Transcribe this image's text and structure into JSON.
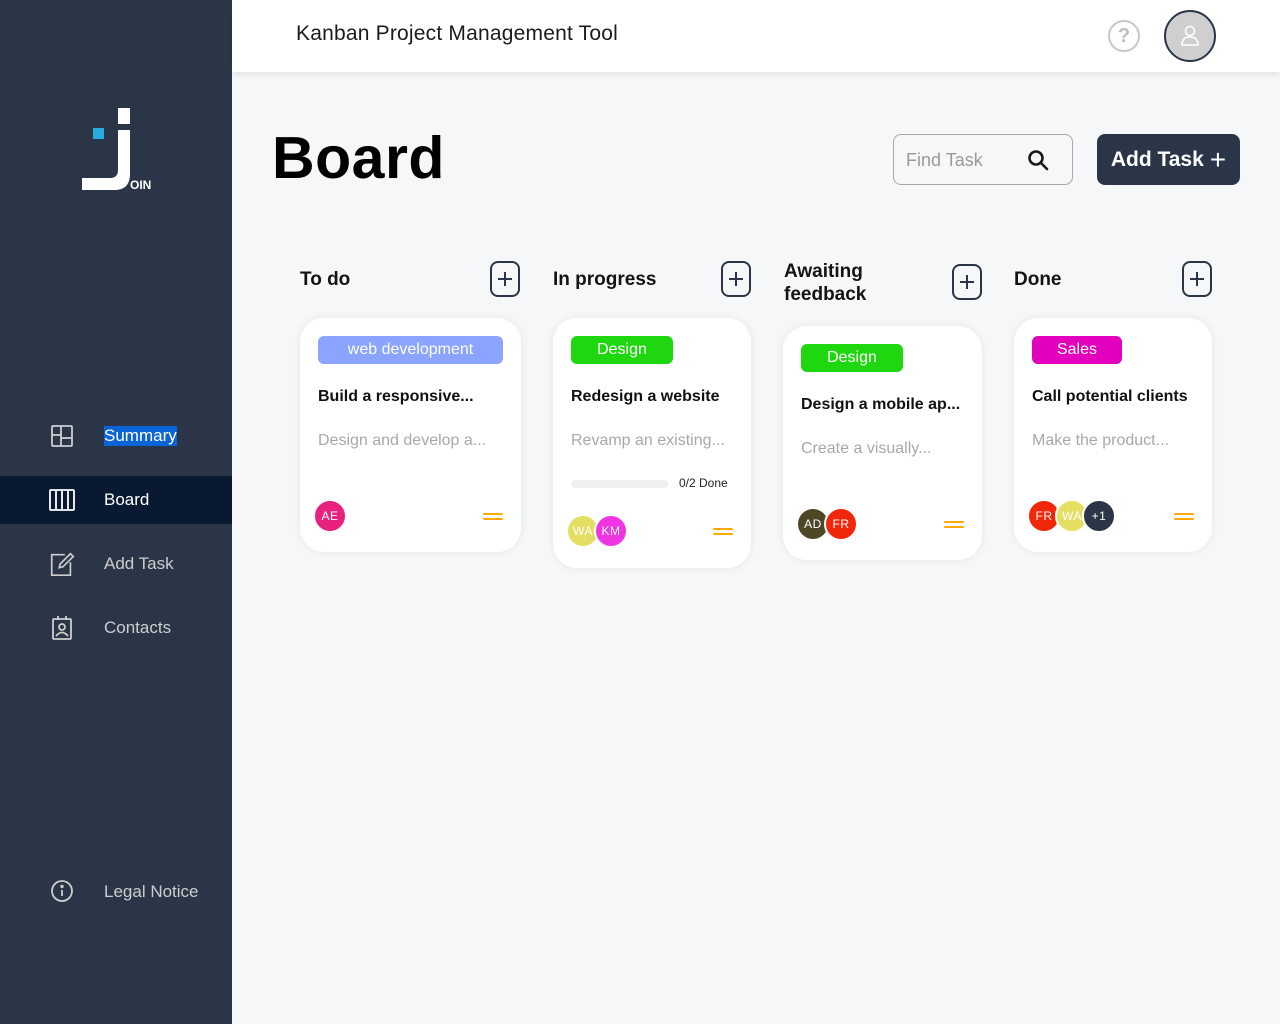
{
  "app": {
    "logo_text": "OIN"
  },
  "header": {
    "title": "Kanban Project Management Tool",
    "help_symbol": "?"
  },
  "sidebar": {
    "items": [
      {
        "label": "Summary",
        "icon": "summary-icon",
        "state": "text-selected"
      },
      {
        "label": "Board",
        "icon": "board-icon",
        "state": "active"
      },
      {
        "label": "Add Task",
        "icon": "add-task-icon",
        "state": "normal"
      },
      {
        "label": "Contacts",
        "icon": "contacts-icon",
        "state": "normal"
      }
    ],
    "legal": {
      "label": "Legal Notice",
      "icon": "info-icon"
    }
  },
  "board": {
    "title": "Board",
    "search": {
      "placeholder": "Find Task",
      "value": ""
    },
    "add_task_label": "Add Task",
    "add_task_symbol": "+"
  },
  "columns": [
    {
      "title": "To do",
      "cards": [
        {
          "tag": "web development",
          "tag_color": "#8aa4ff",
          "title": "Build a responsive...",
          "description": "Design and develop a...",
          "assignees": [
            {
              "initials": "AE",
              "color": "#e8217f"
            }
          ],
          "priority": "medium"
        }
      ]
    },
    {
      "title": "In progress",
      "cards": [
        {
          "tag": "Design",
          "tag_color": "#1fd70f",
          "title": "Redesign a website",
          "description": "Revamp an existing...",
          "progress": {
            "done": 0,
            "total": 2,
            "label": "0/2 Done"
          },
          "assignees": [
            {
              "initials": "WA",
              "color": "#e4de63"
            },
            {
              "initials": "KM",
              "color": "#ee35e1"
            }
          ],
          "priority": "medium"
        }
      ]
    },
    {
      "title_line1": "Awaiting",
      "title_line2": "feedback",
      "cards": [
        {
          "tag": "Design",
          "tag_color": "#1fd70f",
          "title": "Design a mobile ap...",
          "description": "Create a visually...",
          "assignees": [
            {
              "initials": "AD",
              "color": "#4f4625"
            },
            {
              "initials": "FR",
              "color": "#f1270c"
            }
          ],
          "priority": "medium"
        }
      ]
    },
    {
      "title": "Done",
      "cards": [
        {
          "tag": "Sales",
          "tag_color": "#e200be",
          "title": "Call potential clients",
          "description": "Make the product...",
          "assignees": [
            {
              "initials": "FR",
              "color": "#f1270c"
            },
            {
              "initials": "WA",
              "color": "#e4de63"
            },
            {
              "initials": "+1",
              "color": "#2a3647"
            }
          ],
          "priority": "medium"
        }
      ]
    }
  ],
  "colors": {
    "sidebar": "#2a3647",
    "active_nav": "#091931",
    "priority_medium": "#ffa800",
    "background": "#f6f7f8"
  }
}
